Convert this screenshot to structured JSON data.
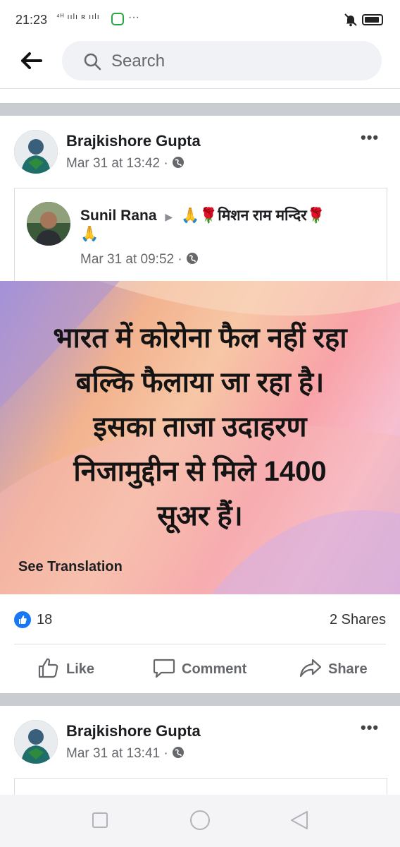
{
  "status_bar": {
    "time": "21:23",
    "signal": "⁴ᴴ ıılı ʀ ıılı"
  },
  "header": {
    "search_placeholder": "Search"
  },
  "post": {
    "author": "Brajkishore Gupta",
    "timestamp": "Mar 31 at 13:42",
    "shared": {
      "author": "Sunil Rana",
      "group": "🙏🌹मिशन राम मन्दिर🌹",
      "group_cont": "🙏",
      "timestamp": "Mar 31 at 09:52"
    },
    "image_text": [
      "भारत में कोरोना फैल नहीं रहा",
      "बल्कि फैलाया जा रहा है।",
      "इसका ताजा उदाहरण",
      "निजामुद्दीन से मिले 1400",
      "सूअर हैं।"
    ],
    "see_translation": "See Translation",
    "like_count": "18",
    "shares": "2 Shares",
    "actions": {
      "like": "Like",
      "comment": "Comment",
      "share": "Share"
    }
  },
  "next_post": {
    "author": "Brajkishore Gupta",
    "timestamp": "Mar 31 at 13:41"
  },
  "colors": {
    "facebook_blue": "#1877f2",
    "secondary_text": "#65676b",
    "separator": "#c9ccd1"
  }
}
